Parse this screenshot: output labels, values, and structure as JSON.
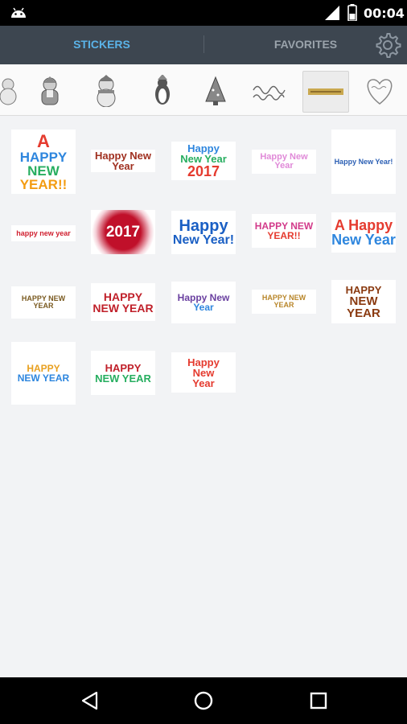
{
  "status": {
    "time": "00:04"
  },
  "tabs": {
    "stickers": "STICKERS",
    "favorites": "FAVORITES"
  },
  "categories": [
    "snowman-small",
    "santa",
    "snowman",
    "penguin",
    "christmas-tree",
    "merry-christmas-text",
    "happy-new-year-banner",
    "heart-text"
  ],
  "stickers": [
    {
      "lines": [
        "A",
        "HAPPY",
        "NEW",
        "YEAR!!"
      ]
    },
    {
      "lines": [
        "Happy New Year"
      ]
    },
    {
      "lines": [
        "Happy",
        "New Year",
        "2017"
      ]
    },
    {
      "lines": [
        "Happy New Year"
      ]
    },
    {
      "lines": [
        "Happy New Year!"
      ]
    },
    {
      "lines": [
        "happy new year"
      ]
    },
    {
      "lines": [
        "2017"
      ]
    },
    {
      "lines": [
        "Happy",
        "New Year!"
      ]
    },
    {
      "lines": [
        "HAPPY NEW",
        "YEAR!!"
      ]
    },
    {
      "lines": [
        "A Happy",
        "New Year"
      ]
    },
    {
      "lines": [
        "HAPPY NEW YEAR"
      ]
    },
    {
      "lines": [
        "HAPPY",
        "NEW YEAR"
      ]
    },
    {
      "lines": [
        "Happy New",
        "Year"
      ]
    },
    {
      "lines": [
        "HAPPY NEW YEAR"
      ]
    },
    {
      "lines": [
        "HAPPY",
        "NEW YEAR"
      ]
    },
    {
      "lines": [
        "HAPPY",
        "NEW YEAR"
      ]
    },
    {
      "lines": [
        "HAPPY",
        "NEW YEAR"
      ]
    },
    {
      "lines": [
        "Happy",
        "New",
        "Year"
      ]
    }
  ],
  "colors": {
    "accent": "#5ab3e8",
    "tabbar": "#3d4650"
  }
}
